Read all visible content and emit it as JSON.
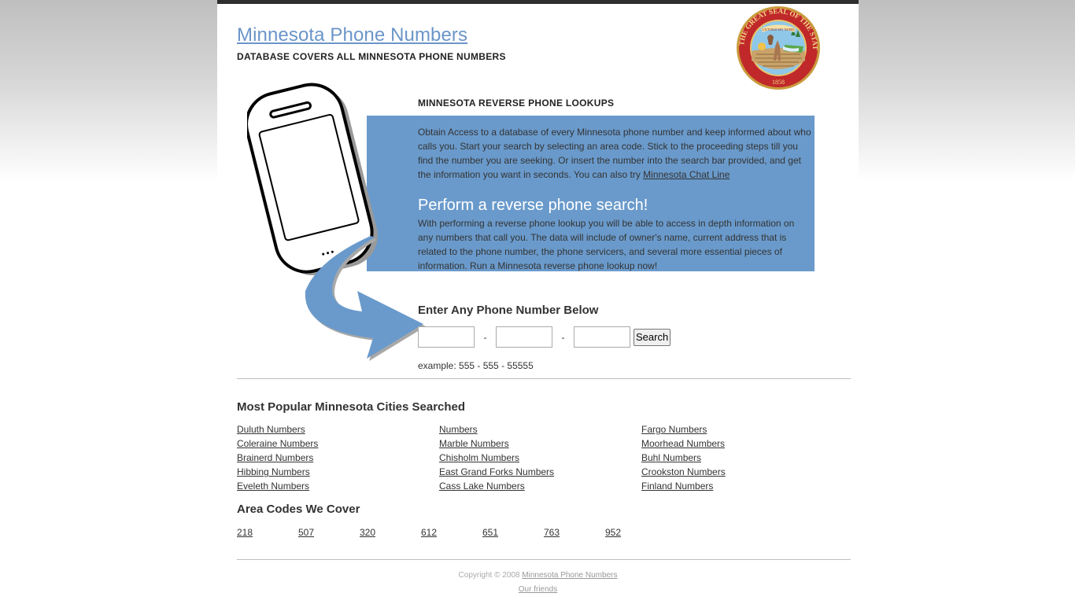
{
  "header": {
    "title": "Minnesota Phone Numbers",
    "tagline": "DATABASE COVERS ALL MINNESOTA PHONE NUMBERS",
    "seal_alt": "Great Seal of the State of Minnesota",
    "seal_text": "THE GREAT SEAL OF THE STATE OF MINNESOTA",
    "seal_year": "1858",
    "seal_motto": "L'ETOILE DU NORD"
  },
  "lookup": {
    "title": "MINNESOTA REVERSE PHONE LOOKUPS",
    "intro_text": "Obtain Access to a database of every Minnesota phone number and keep informed about who calls you. Start your search by selecting an area code. Stick to the proceeding steps till you find the number you are seeking. Or insert the number into the search bar provided, and get the information you want in seconds. You can also try ",
    "intro_link": "Minnesota Chat Line",
    "perform_title": "Perform a reverse phone search!",
    "perform_text": "With performing a reverse phone lookup you will be able to access in depth information on any numbers that call you. The data will include of owner's name, current address that is related to the phone number, the phone servicers, and several more essential pieces of information. Run a Minnesota reverse phone lookup now!"
  },
  "search": {
    "title": "Enter Any Phone Number Below",
    "area_value": "",
    "prefix_value": "",
    "line_value": "",
    "separator": "-",
    "button_label": "Search",
    "example": "example: 555 - 555 - 55555"
  },
  "cities": {
    "title": "Most Popular Minnesota Cities Searched",
    "columns": [
      [
        "Duluth Numbers",
        "Coleraine Numbers",
        "Brainerd Numbers",
        "Hibbing Numbers",
        "Eveleth Numbers"
      ],
      [
        "Numbers",
        "Marble Numbers",
        "Chisholm Numbers",
        "East Grand Forks Numbers",
        "Cass Lake Numbers"
      ],
      [
        "Fargo Numbers",
        "Moorhead Numbers",
        "Buhl Numbers",
        "Crookston Numbers",
        "Finland Numbers"
      ]
    ]
  },
  "area_codes": {
    "title": "Area Codes We Cover",
    "codes": [
      "218",
      "507",
      "320",
      "612",
      "651",
      "763",
      "952"
    ]
  },
  "footer": {
    "copyright": "Copyright © 2008 ",
    "site_link": "Minnesota Phone Numbers",
    "friends_link": "Our friends"
  },
  "colors": {
    "accent_blue": "#6a9acb",
    "title_link": "#6b95c8",
    "top_bar": "#2e2e2e"
  }
}
